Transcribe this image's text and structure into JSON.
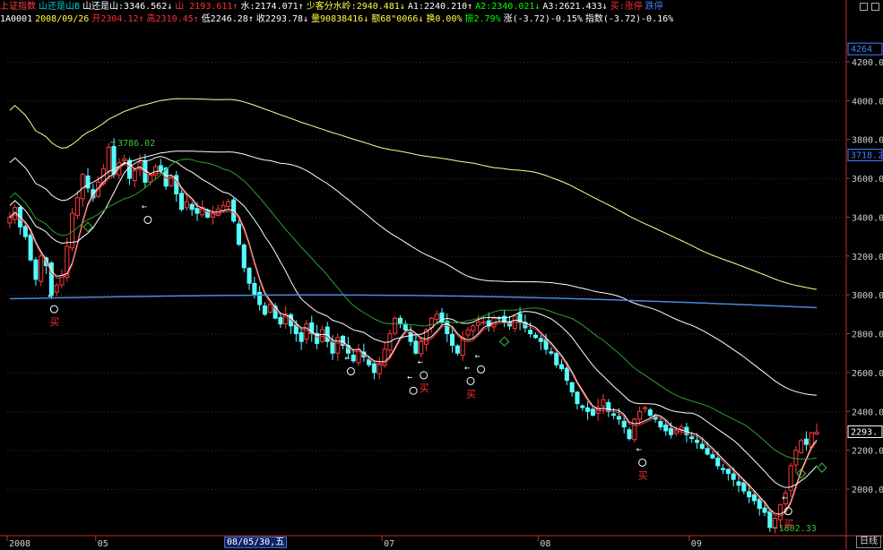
{
  "header": {
    "row1": [
      {
        "text": "上证指数",
        "color": "#ff4040"
      },
      {
        "text": "山还是山B",
        "color": "#00c8c8"
      },
      {
        "text": "山还是山:3346.562↓",
        "color": "#ffffff"
      },
      {
        "text": "山 2193.611↑",
        "color": "#ff3030"
      },
      {
        "text": "水:2174.071↑",
        "color": "#ffffff"
      },
      {
        "text": "少客分水岭:2940.481↓",
        "color": "#ffff40"
      },
      {
        "text": "A1:2240.210↑",
        "color": "#ffffff"
      },
      {
        "text": "A2:2340.021↓",
        "color": "#00ff00"
      },
      {
        "text": "A3:2621.433↓",
        "color": "#ffffff"
      },
      {
        "text": "买:涨停",
        "color": "#ff3030"
      },
      {
        "text": "跌停",
        "color": "#4080ff"
      }
    ],
    "row2": [
      {
        "text": "1A0001",
        "color": "#ffffff"
      },
      {
        "text": "2008/09/26",
        "color": "#ffff40"
      },
      {
        "text": "开2304.12↑",
        "color": "#ff3030"
      },
      {
        "text": "高2310.45↑",
        "color": "#ff3030"
      },
      {
        "text": "低2246.28↑",
        "color": "#ffffff"
      },
      {
        "text": "收2293.78↓",
        "color": "#ffffff"
      },
      {
        "text": "量90838416↓",
        "color": "#ffff40"
      },
      {
        "text": "额68\"0066↓",
        "color": "#ffff40"
      },
      {
        "text": "换0.00%",
        "color": "#ffff40"
      },
      {
        "text": "振2.79%",
        "color": "#00ff00"
      },
      {
        "text": "涨(-3.72)-0.15%",
        "color": "#ffffff"
      },
      {
        "text": "指数(-3.72)-0.16%",
        "color": "#ffffff"
      }
    ]
  },
  "chart_data": {
    "type": "candlestick",
    "ylim": [
      1760,
      4380
    ],
    "y_ticks": [
      2000,
      2200,
      2400,
      2600,
      2800,
      3000,
      3200,
      3400,
      3600,
      3800,
      4000,
      4200
    ],
    "x_labels": [
      {
        "index": 0,
        "text": "2008"
      },
      {
        "index": 17,
        "text": "05"
      },
      {
        "index": 72,
        "text": "07"
      },
      {
        "index": 102,
        "text": "08"
      },
      {
        "index": 131,
        "text": "09"
      }
    ],
    "highlighted_date": "08/05/30,五",
    "period_label": "日线",
    "right_labels": [
      {
        "value": 4264,
        "text": "4264",
        "color": "#4080ff"
      },
      {
        "value": 3718,
        "text": "3718.2",
        "color": "#4080ff"
      },
      {
        "value": 2293,
        "text": "2293.",
        "color": "#ffffff"
      }
    ],
    "annotations": [
      {
        "type": "text",
        "i": 20,
        "v": 3786,
        "text": "3786.02",
        "color": "#40c040"
      },
      {
        "type": "text",
        "i": 147,
        "v": 1802,
        "text": "1802.33",
        "color": "#40c040"
      }
    ],
    "signals": [
      {
        "i": 8,
        "v": 3000,
        "kind": "buy"
      },
      {
        "i": 26,
        "v": 3460,
        "kind": "mark"
      },
      {
        "i": 65,
        "v": 2680,
        "kind": "mark"
      },
      {
        "i": 77,
        "v": 2580,
        "kind": "mark"
      },
      {
        "i": 79,
        "v": 2660,
        "kind": "buy"
      },
      {
        "i": 88,
        "v": 2630,
        "kind": "buy"
      },
      {
        "i": 90,
        "v": 2690,
        "kind": "mark"
      },
      {
        "i": 121,
        "v": 2210,
        "kind": "buy"
      },
      {
        "i": 149,
        "v": 1960,
        "kind": "buy"
      }
    ],
    "diamonds": [
      {
        "i": 15,
        "v": 3350,
        "color": "#40c040"
      },
      {
        "i": 95,
        "v": 2760,
        "color": "#40c040"
      },
      {
        "i": 152,
        "v": 2080,
        "color": "#40c040"
      },
      {
        "i": 156,
        "v": 2110,
        "color": "#40c040"
      }
    ],
    "closes": [
      3400,
      3450,
      3350,
      3300,
      3180,
      3080,
      3200,
      3150,
      3000,
      3050,
      3100,
      3250,
      3420,
      3500,
      3620,
      3550,
      3500,
      3580,
      3650,
      3760,
      3620,
      3680,
      3700,
      3600,
      3640,
      3680,
      3580,
      3620,
      3660,
      3640,
      3560,
      3600,
      3520,
      3440,
      3480,
      3440,
      3420,
      3450,
      3400,
      3420,
      3440,
      3460,
      3480,
      3380,
      3260,
      3140,
      3060,
      3000,
      2950,
      2900,
      2950,
      2880,
      2850,
      2900,
      2840,
      2800,
      2760,
      2850,
      2800,
      2750,
      2820,
      2760,
      2700,
      2780,
      2740,
      2700,
      2660,
      2720,
      2680,
      2640,
      2600,
      2640,
      2720,
      2800,
      2880,
      2850,
      2820,
      2760,
      2700,
      2760,
      2820,
      2880,
      2900,
      2860,
      2800,
      2740,
      2700,
      2780,
      2820,
      2840,
      2860,
      2860,
      2840,
      2880,
      2880,
      2860,
      2840,
      2890,
      2860,
      2830,
      2800,
      2780,
      2760,
      2720,
      2700,
      2640,
      2620,
      2560,
      2500,
      2440,
      2420,
      2400,
      2380,
      2420,
      2460,
      2400,
      2380,
      2360,
      2320,
      2260,
      2360,
      2400,
      2420,
      2380,
      2360,
      2320,
      2300,
      2280,
      2300,
      2320,
      2280,
      2260,
      2240,
      2210,
      2180,
      2160,
      2120,
      2100,
      2080,
      2050,
      2020,
      1990,
      1960,
      1940,
      1900,
      1880,
      1802,
      1850,
      1920,
      1980,
      2120,
      2200,
      2250,
      2230,
      2290,
      2293
    ]
  }
}
